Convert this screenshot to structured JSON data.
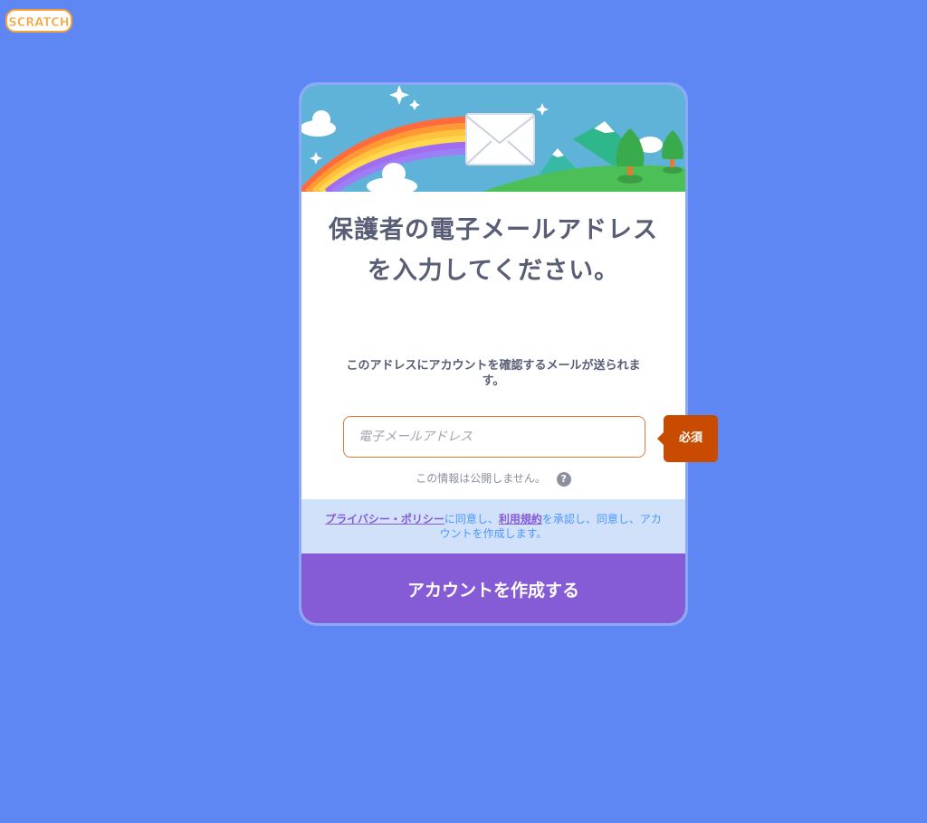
{
  "logo": {
    "text": "SCRATCH"
  },
  "card": {
    "title": "保護者の電子メールアドレスを入力してください。",
    "subtitle": "このアドレスにアカウントを確認するメールが送られます。",
    "email": {
      "value": "",
      "placeholder": "電子メールアドレス"
    },
    "required_label": "必須",
    "privacy_note": "この情報は公開しません。",
    "help_icon": "question-icon",
    "terms": {
      "privacy_link": "プライバシー・ポリシー",
      "text1": "に同意し、",
      "tos_link": "利用規約",
      "text2": "を承認し、同意し、アカウントを作成します。"
    },
    "submit_label": "アカウントを作成する"
  },
  "colors": {
    "background": "#5f87f3",
    "card_border": "#8ca9f7",
    "title_text": "#575e75",
    "input_border": "#e07a3d",
    "required_bg": "#c84b00",
    "terms_bg": "#d1e1f9",
    "link": "#855cd6",
    "submit_bg": "#855cd6"
  }
}
